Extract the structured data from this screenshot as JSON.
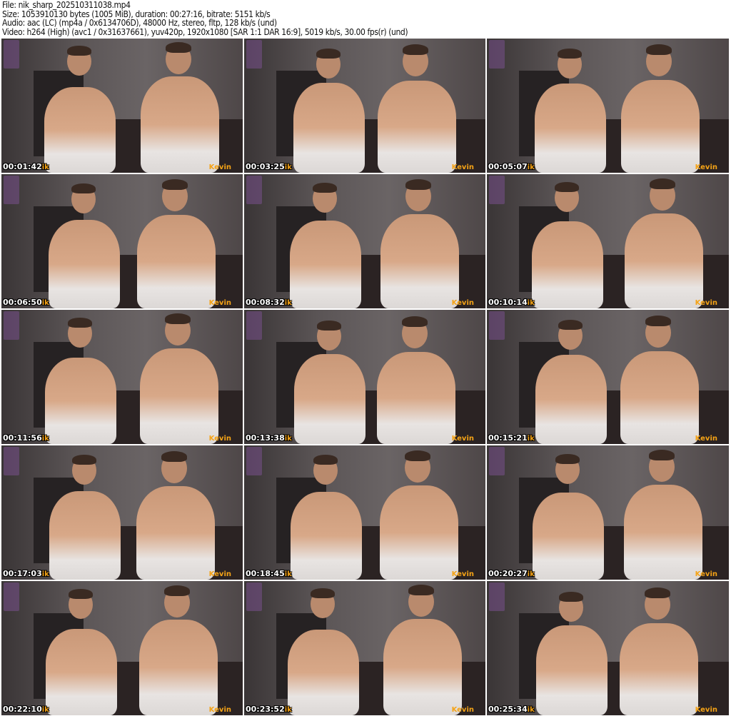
{
  "header": {
    "file": "File: nik_sharp_202510311038.mp4",
    "size": "Size: 1053910130 bytes (1005 MiB), duration: 00:27:16, bitrate: 5151 kb/s",
    "audio": "Audio: aac (LC) (mp4a / 0x6134706D), 48000 Hz, stereo, fltp, 128 kb/s (und)",
    "video": "Video: h264 (High) (avc1 / 0x31637661), yuv420p, 1920x1080 [SAR 1:1 DAR 16:9], 5019 kb/s, 30.00 fps(r) (und)"
  },
  "overlay": {
    "left_name_fragment": "ik",
    "right_name": "Kevin"
  },
  "colors": {
    "label": "#f5a316",
    "timestamp": "#ffffff"
  },
  "thumbnails": [
    {
      "time": "00:01:42"
    },
    {
      "time": "00:03:25"
    },
    {
      "time": "00:05:07"
    },
    {
      "time": "00:06:50"
    },
    {
      "time": "00:08:32"
    },
    {
      "time": "00:10:14"
    },
    {
      "time": "00:11:56"
    },
    {
      "time": "00:13:38"
    },
    {
      "time": "00:15:21"
    },
    {
      "time": "00:17:03"
    },
    {
      "time": "00:18:45"
    },
    {
      "time": "00:20:27"
    },
    {
      "time": "00:22:10"
    },
    {
      "time": "00:23:52"
    },
    {
      "time": "00:25:34"
    }
  ]
}
